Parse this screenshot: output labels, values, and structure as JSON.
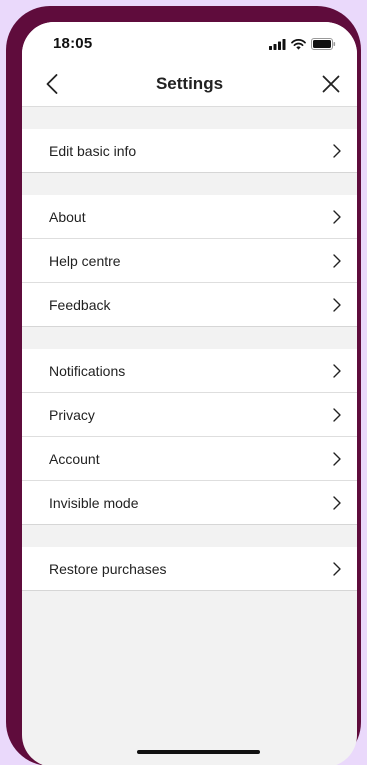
{
  "status_bar": {
    "time": "18:05",
    "icons": [
      "cellular-signal-icon",
      "wifi-icon",
      "battery-icon"
    ]
  },
  "nav": {
    "title": "Settings",
    "back_icon": "chevron-left-icon",
    "close_icon": "close-icon"
  },
  "sections": [
    {
      "items": [
        {
          "label": "Edit basic info"
        }
      ]
    },
    {
      "items": [
        {
          "label": "About"
        },
        {
          "label": "Help centre"
        },
        {
          "label": "Feedback"
        }
      ]
    },
    {
      "items": [
        {
          "label": "Notifications"
        },
        {
          "label": "Privacy"
        },
        {
          "label": "Account"
        },
        {
          "label": "Invisible mode"
        }
      ]
    },
    {
      "items": [
        {
          "label": "Restore purchases"
        }
      ]
    }
  ],
  "colors": {
    "page_background": "#ead9fb",
    "phone_frame": "#5f0c3c",
    "screen_background": "#f2f2f2",
    "row_background": "#ffffff",
    "text": "#222222"
  }
}
